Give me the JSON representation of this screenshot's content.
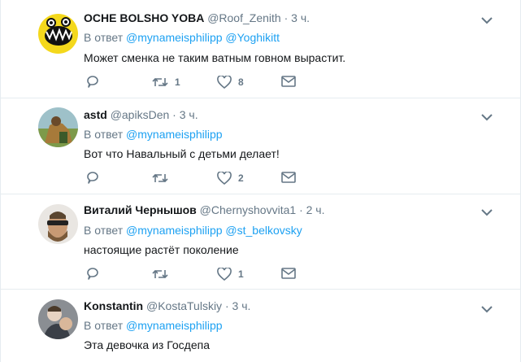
{
  "reply_prefix": "В ответ",
  "tweets": [
    {
      "name": "OCHE BOLSHO YOBA",
      "handle": "@Roof_Zenith",
      "dot": "·",
      "time": "3 ч.",
      "mentions": [
        "@mynameisphilipp",
        "@Yoghikitt"
      ],
      "text": "Может сменка не таким ватным говном вырастит.",
      "reply_count": "",
      "retweet_count": "1",
      "like_count": "8"
    },
    {
      "name": "astd",
      "handle": "@apiksDen",
      "dot": "·",
      "time": "3 ч.",
      "mentions": [
        "@mynameisphilipp"
      ],
      "text": "Вот что Навальный с детьми делает!",
      "reply_count": "",
      "retweet_count": "",
      "like_count": "2"
    },
    {
      "name": "Виталий Чернышов",
      "handle": "@Chernyshovvita1",
      "dot": "·",
      "time": "2 ч.",
      "mentions": [
        "@mynameisphilipp",
        "@st_belkovsky"
      ],
      "text": "настоящие растёт поколение",
      "reply_count": "",
      "retweet_count": "",
      "like_count": "1"
    },
    {
      "name": "Konstantin",
      "handle": "@KostaTulskiy",
      "dot": "·",
      "time": "3 ч.",
      "mentions": [
        "@mynameisphilipp"
      ],
      "text": "Эта девочка из Госдепа"
    }
  ],
  "colors": {
    "accent": "#1da1f2",
    "muted": "#657786",
    "border": "#e6ecf0",
    "text": "#14171a"
  },
  "icons": [
    "reply-icon",
    "retweet-icon",
    "like-icon",
    "direct-message-icon",
    "chevron-down-icon"
  ]
}
